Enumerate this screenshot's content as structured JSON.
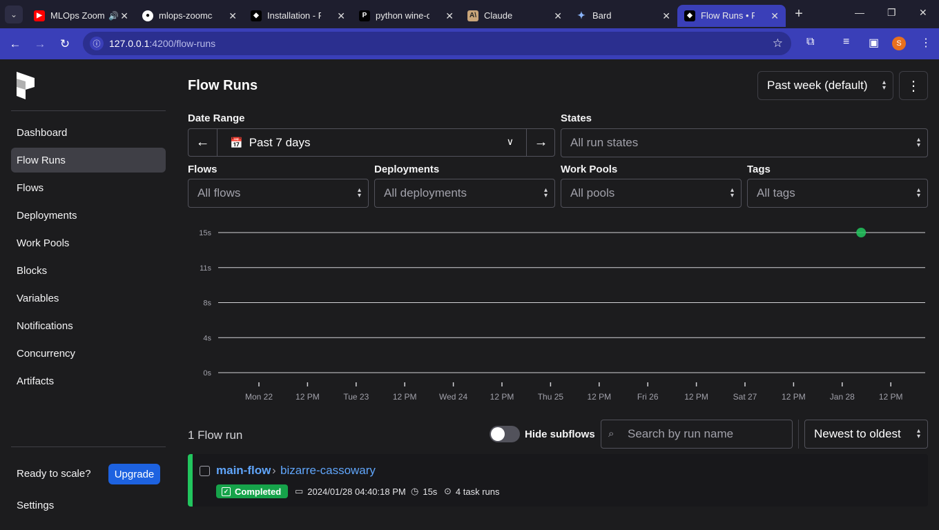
{
  "browser": {
    "tabs": [
      {
        "title": "MLOps Zoomcamp",
        "favicon": "youtube-icon",
        "audio": true
      },
      {
        "title": "mlops-zoomcamp",
        "favicon": "github-icon"
      },
      {
        "title": "Installation - Prefect",
        "favicon": "prefect-icon"
      },
      {
        "title": "python wine-quality",
        "favicon": "p-icon"
      },
      {
        "title": "Claude",
        "favicon": "claude-icon"
      },
      {
        "title": "Bard",
        "favicon": "bard-icon"
      },
      {
        "title": "Flow Runs • Prefect",
        "favicon": "prefect-icon",
        "active": true
      }
    ],
    "url_host": "127.0.0.1",
    "url_path": ":4200/flow-runs",
    "profile_initial": "S"
  },
  "sidebar": {
    "items": [
      {
        "label": "Dashboard"
      },
      {
        "label": "Flow Runs",
        "active": true
      },
      {
        "label": "Flows"
      },
      {
        "label": "Deployments"
      },
      {
        "label": "Work Pools"
      },
      {
        "label": "Blocks"
      },
      {
        "label": "Variables"
      },
      {
        "label": "Notifications"
      },
      {
        "label": "Concurrency"
      },
      {
        "label": "Artifacts"
      }
    ],
    "ready_text": "Ready to scale?",
    "upgrade_label": "Upgrade",
    "settings_label": "Settings"
  },
  "header": {
    "title": "Flow Runs",
    "range_select": "Past week (default)",
    "kebab": "⋮"
  },
  "filters": {
    "date_range_label": "Date Range",
    "date_range_value": "Past 7 days",
    "states_label": "States",
    "states_value": "All run states",
    "flows_label": "Flows",
    "flows_value": "All flows",
    "deployments_label": "Deployments",
    "deployments_value": "All deployments",
    "pools_label": "Work Pools",
    "pools_value": "All pools",
    "tags_label": "Tags",
    "tags_value": "All tags"
  },
  "chart_data": {
    "type": "scatter",
    "y_ticks": [
      "15s",
      "11s",
      "8s",
      "4s",
      "0s"
    ],
    "x_ticks": [
      "Mon 22",
      "12 PM",
      "Tue 23",
      "12 PM",
      "Wed 24",
      "12 PM",
      "Thu 25",
      "12 PM",
      "Fri 26",
      "12 PM",
      "Sat 27",
      "12 PM",
      "Jan 28",
      "12 PM"
    ],
    "points": [
      {
        "x": "Jan 28 16:40",
        "y": 15,
        "state": "Completed"
      }
    ],
    "ylim": [
      0,
      15
    ],
    "colors": {
      "completed": "#22c55e"
    },
    "grid": true
  },
  "list": {
    "count_text": "1 Flow run",
    "hide_subflows_label": "Hide subflows",
    "search_placeholder": "Search by run name",
    "sort_value": "Newest to oldest"
  },
  "run": {
    "flow_name": "main-flow",
    "run_name": "bizarre-cassowary",
    "state": "Completed",
    "start_time": "2024/01/28 04:40:18 PM",
    "duration": "15s",
    "task_runs": "4 task runs"
  }
}
